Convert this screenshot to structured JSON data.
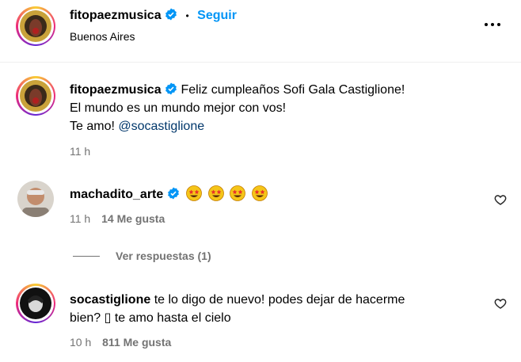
{
  "header": {
    "username": "fitopaezmusica",
    "separator": "•",
    "follow_label": "Seguir",
    "location": "Buenos Aires",
    "more_icon": "more-horizontal-icon"
  },
  "caption": {
    "username": "fitopaezmusica",
    "line1": "Feliz cumpleaños Sofi Gala Castiglione!",
    "line2": "El mundo es un mundo mejor con vos!",
    "line3_prefix": "Te amo!",
    "mention": "@socastiglione",
    "time": "11 h"
  },
  "comments": [
    {
      "username": "machadito_arte",
      "emojis": [
        "star-struck-emoji",
        "star-struck-emoji",
        "star-struck-emoji",
        "star-struck-emoji"
      ],
      "time": "11 h",
      "likes": "14 Me gusta",
      "replies_label": "Ver respuestas (1)"
    },
    {
      "username": "socastiglione",
      "line1": "te lo digo de nuevo! podes dejar de hacerme",
      "line2": "bien? ▯ te amo hasta el cielo",
      "time": "10 h",
      "likes": "811 Me gusta"
    }
  ],
  "colors": {
    "verified_blue": "#0095f6",
    "link_blue": "#00376b",
    "follow_blue": "#0095f6",
    "meta_gray": "#737373"
  }
}
